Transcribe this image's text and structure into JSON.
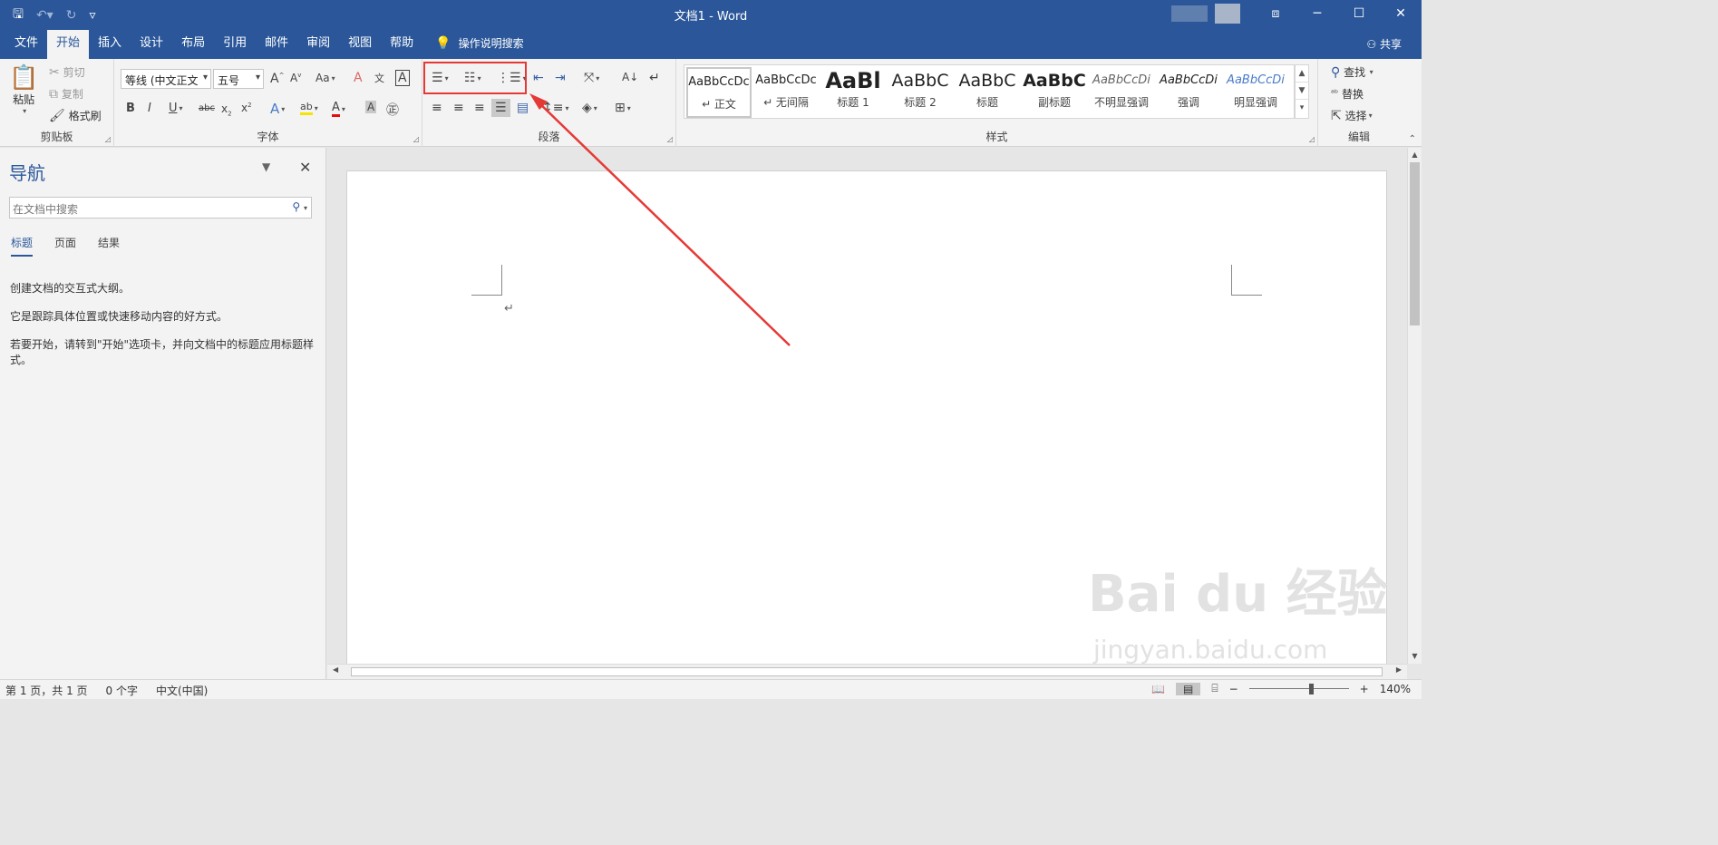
{
  "window": {
    "title": "文档1 - Word",
    "share_label": "共享"
  },
  "tabs": [
    "文件",
    "开始",
    "插入",
    "设计",
    "布局",
    "引用",
    "邮件",
    "审阅",
    "视图",
    "帮助"
  ],
  "tell_me": "操作说明搜索",
  "clipboard": {
    "paste": "粘贴",
    "cut": "剪切",
    "copy": "复制",
    "format_painter": "格式刷",
    "label": "剪贴板"
  },
  "font": {
    "name": "等线 (中文正文",
    "size": "五号",
    "label": "字体"
  },
  "paragraph": {
    "label": "段落"
  },
  "styles": {
    "label": "样式",
    "items": [
      {
        "sample": "AaBbCcDc",
        "name": "↵ 正文"
      },
      {
        "sample": "AaBbCcDc",
        "name": "↵ 无间隔"
      },
      {
        "sample": "AaBl",
        "name": "标题 1"
      },
      {
        "sample": "AaBbC",
        "name": "标题 2"
      },
      {
        "sample": "AaBbC",
        "name": "标题"
      },
      {
        "sample": "AaBbC",
        "name": "副标题"
      },
      {
        "sample": "AaBbCcDi",
        "name": "不明显强调"
      },
      {
        "sample": "AaBbCcDi",
        "name": "强调"
      },
      {
        "sample": "AaBbCcDi",
        "name": "明显强调"
      }
    ]
  },
  "editing": {
    "find": "查找",
    "replace": "替换",
    "select": "选择",
    "label": "编辑"
  },
  "nav": {
    "title": "导航",
    "search_placeholder": "在文档中搜索",
    "tabs": [
      "标题",
      "页面",
      "结果"
    ],
    "msg1": "创建文档的交互式大纲。",
    "msg2": "它是跟踪具体位置或快速移动内容的好方式。",
    "msg3": "若要开始，请转到\"开始\"选项卡，并向文档中的标题应用标题样式。"
  },
  "status": {
    "page": "第 1 页，共 1 页",
    "words": "0 个字",
    "lang": "中文(中国)",
    "zoom": "140%"
  },
  "watermark": {
    "brand": "Bai du 经验",
    "url": "jingyan.baidu.com"
  },
  "colors": {
    "accent": "#2b579a",
    "highlight_box": "#e53935"
  }
}
